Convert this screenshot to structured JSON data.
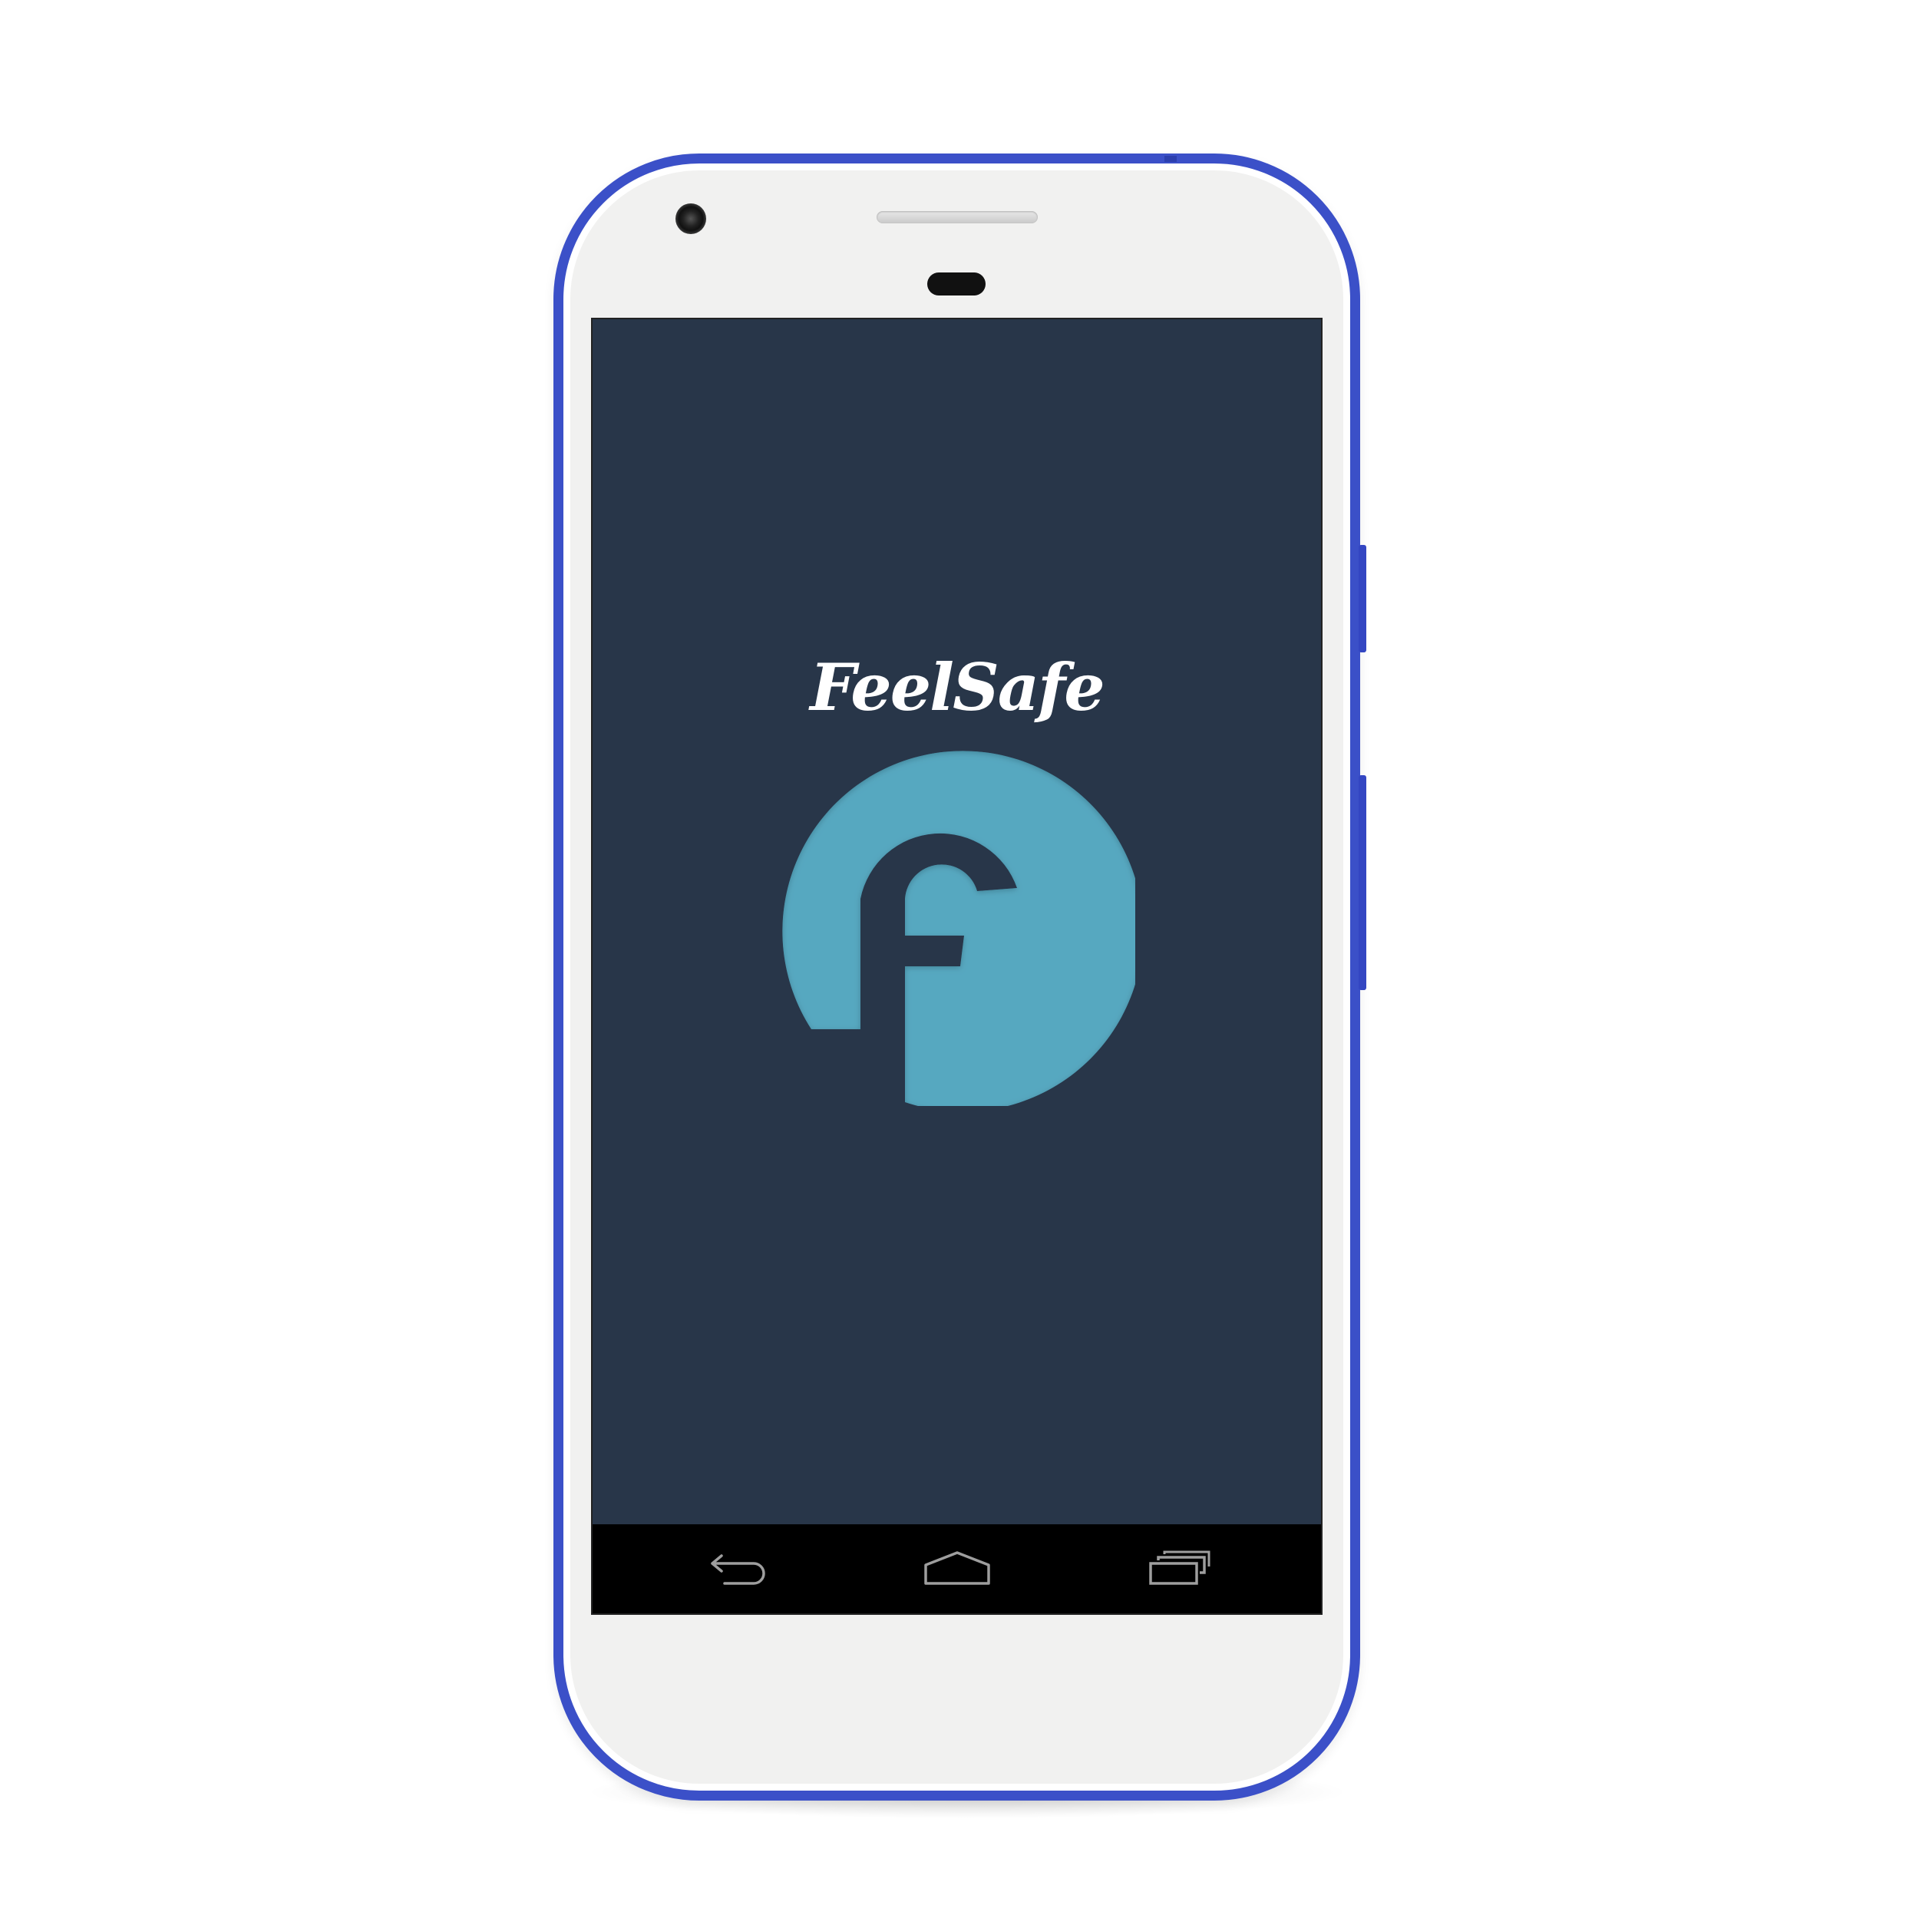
{
  "app": {
    "name": "FeelSafe",
    "logo_letter": "f"
  },
  "colors": {
    "screen_background": "#283649",
    "logo_circle": "#57a8c0",
    "phone_frame": "#3b50c8",
    "nav_bar": "#000000"
  },
  "navigation_bar": {
    "buttons": [
      {
        "icon": "back-arrow-icon"
      },
      {
        "icon": "home-icon"
      },
      {
        "icon": "recent-apps-icon"
      }
    ]
  }
}
